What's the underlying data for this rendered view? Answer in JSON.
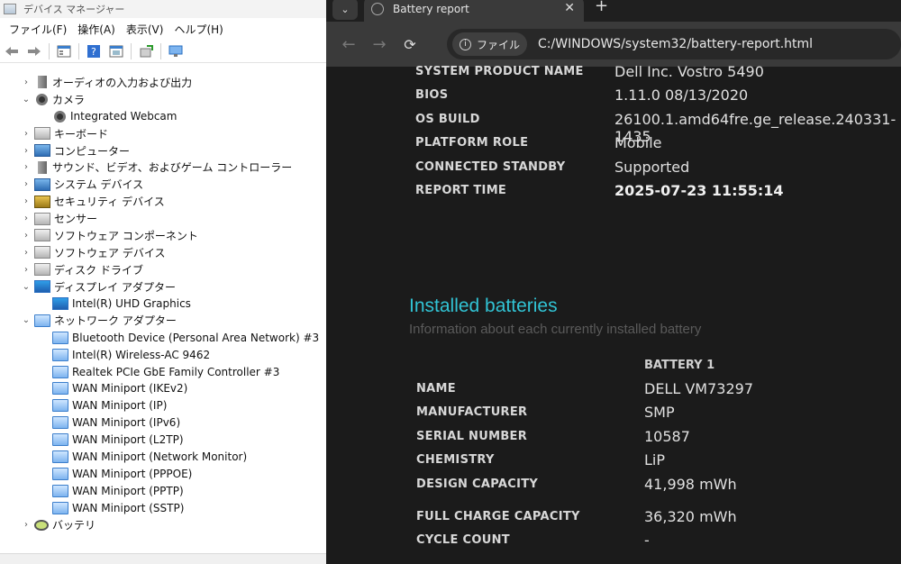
{
  "device_manager": {
    "title": "デバイス マネージャー",
    "menu": [
      "ファイル(F)",
      "操作(A)",
      "表示(V)",
      "ヘルプ(H)"
    ],
    "tree": [
      {
        "label": "オーディオの入力および出力",
        "expander": "›",
        "indent": 0,
        "icon": "audio"
      },
      {
        "label": "カメラ",
        "expander": "⌄",
        "indent": 0,
        "icon": "camera"
      },
      {
        "label": "Integrated Webcam",
        "expander": "",
        "indent": 1,
        "icon": "camera"
      },
      {
        "label": "キーボード",
        "expander": "›",
        "indent": 0,
        "icon": "keyboard"
      },
      {
        "label": "コンピューター",
        "expander": "›",
        "indent": 0,
        "icon": "computer"
      },
      {
        "label": "サウンド、ビデオ、およびゲーム コントローラー",
        "expander": "›",
        "indent": 0,
        "icon": "audio"
      },
      {
        "label": "システム デバイス",
        "expander": "›",
        "indent": 0,
        "icon": "computer"
      },
      {
        "label": "セキュリティ デバイス",
        "expander": "›",
        "indent": 0,
        "icon": "security"
      },
      {
        "label": "センサー",
        "expander": "›",
        "indent": 0,
        "icon": "generic"
      },
      {
        "label": "ソフトウェア コンポーネント",
        "expander": "›",
        "indent": 0,
        "icon": "generic"
      },
      {
        "label": "ソフトウェア デバイス",
        "expander": "›",
        "indent": 0,
        "icon": "generic"
      },
      {
        "label": "ディスク ドライブ",
        "expander": "›",
        "indent": 0,
        "icon": "generic"
      },
      {
        "label": "ディスプレイ アダプター",
        "expander": "⌄",
        "indent": 0,
        "icon": "display"
      },
      {
        "label": "Intel(R) UHD Graphics",
        "expander": "",
        "indent": 1,
        "icon": "display"
      },
      {
        "label": "ネットワーク アダプター",
        "expander": "⌄",
        "indent": 0,
        "icon": "network"
      },
      {
        "label": "Bluetooth Device (Personal Area Network) #3",
        "expander": "",
        "indent": 1,
        "icon": "network"
      },
      {
        "label": "Intel(R) Wireless-AC 9462",
        "expander": "",
        "indent": 1,
        "icon": "network"
      },
      {
        "label": "Realtek PCIe GbE Family Controller #3",
        "expander": "",
        "indent": 1,
        "icon": "network"
      },
      {
        "label": "WAN Miniport (IKEv2)",
        "expander": "",
        "indent": 1,
        "icon": "network"
      },
      {
        "label": "WAN Miniport (IP)",
        "expander": "",
        "indent": 1,
        "icon": "network"
      },
      {
        "label": "WAN Miniport (IPv6)",
        "expander": "",
        "indent": 1,
        "icon": "network"
      },
      {
        "label": "WAN Miniport (L2TP)",
        "expander": "",
        "indent": 1,
        "icon": "network"
      },
      {
        "label": "WAN Miniport (Network Monitor)",
        "expander": "",
        "indent": 1,
        "icon": "network"
      },
      {
        "label": "WAN Miniport (PPPOE)",
        "expander": "",
        "indent": 1,
        "icon": "network"
      },
      {
        "label": "WAN Miniport (PPTP)",
        "expander": "",
        "indent": 1,
        "icon": "network"
      },
      {
        "label": "WAN Miniport (SSTP)",
        "expander": "",
        "indent": 1,
        "icon": "network"
      },
      {
        "label": "バッテリ",
        "expander": "›",
        "indent": 0,
        "icon": "battery"
      }
    ]
  },
  "browser": {
    "tab_title": "Battery report",
    "chip_label": "ファイル",
    "url": "C:/WINDOWS/system32/battery-report.html",
    "system_info": [
      {
        "key": "SYSTEM PRODUCT NAME",
        "value": "Dell Inc. Vostro 5490"
      },
      {
        "key": "BIOS",
        "value": "1.11.0 08/13/2020"
      },
      {
        "key": "OS BUILD",
        "value": "26100.1.amd64fre.ge_release.240331-1435"
      },
      {
        "key": "PLATFORM ROLE",
        "value": "Mobile"
      },
      {
        "key": "CONNECTED STANDBY",
        "value": "Supported"
      },
      {
        "key": "REPORT TIME",
        "value": "2025-07-23  11:55:14"
      }
    ],
    "section_title": "Installed batteries",
    "section_subtitle": "Information about each currently installed battery",
    "battery_header": "BATTERY 1",
    "battery_info": [
      {
        "key": "NAME",
        "value": "DELL VM73297"
      },
      {
        "key": "MANUFACTURER",
        "value": "SMP"
      },
      {
        "key": "SERIAL NUMBER",
        "value": "10587"
      },
      {
        "key": "CHEMISTRY",
        "value": "LiP"
      },
      {
        "key": "DESIGN CAPACITY",
        "value": "41,998 mWh"
      },
      {
        "key": "FULL CHARGE CAPACITY",
        "value": "36,320 mWh"
      },
      {
        "key": "CYCLE COUNT",
        "value": "-"
      }
    ]
  },
  "colors": {
    "accent": "#31c3d4",
    "page_bg": "#1b1b1b",
    "toolbar_bg": "#3a3a3a"
  }
}
